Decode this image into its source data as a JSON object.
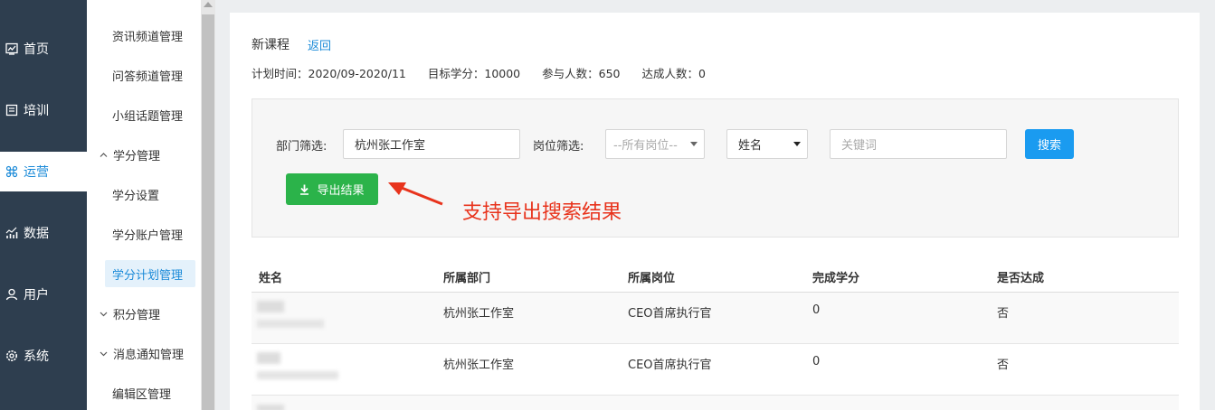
{
  "nav": {
    "items": [
      {
        "label": "首页",
        "icon": "dashboard-icon",
        "active": false
      },
      {
        "label": "培训",
        "icon": "book-icon",
        "active": false
      },
      {
        "label": "运营",
        "icon": "command-icon",
        "active": true
      },
      {
        "label": "数据",
        "icon": "bar-chart-icon",
        "active": false
      },
      {
        "label": "用户",
        "icon": "user-icon",
        "active": false
      },
      {
        "label": "系统",
        "icon": "gear-icon",
        "active": false
      }
    ]
  },
  "submenu": {
    "items": [
      {
        "label": "资讯频道管理"
      },
      {
        "label": "问答频道管理"
      },
      {
        "label": "小组话题管理"
      },
      {
        "label": "学分管理",
        "group": true
      },
      {
        "label": "学分设置"
      },
      {
        "label": "学分账户管理"
      },
      {
        "label": "学分计划管理",
        "active": true
      },
      {
        "label": "积分管理",
        "group": true
      },
      {
        "label": "消息通知管理",
        "group": true
      },
      {
        "label": "编辑区管理"
      }
    ]
  },
  "page": {
    "title": "新课程",
    "back_label": "返回",
    "stats": {
      "plan_time": "计划时间：2020/09-2020/11",
      "target_credits": "目标学分：10000",
      "participants": "参与人数：650",
      "achievers": "达成人数：0"
    }
  },
  "filter": {
    "dept_label": "部门筛选:",
    "dept_value": "杭州张工作室",
    "position_label": "岗位筛选:",
    "position_value": "--所有岗位--",
    "field_value": "姓名",
    "keyword_placeholder": "关键词",
    "search_label": "搜索",
    "export_label": "导出结果"
  },
  "annotation": {
    "text": "支持导出搜索结果",
    "color": "#e8331c"
  },
  "table": {
    "headers": [
      "姓名",
      "所属部门",
      "所属岗位",
      "完成学分",
      "是否达成"
    ],
    "rows": [
      {
        "dept": "杭州张工作室",
        "position": "CEO首席执行官",
        "credits": "0",
        "achieved": "否"
      },
      {
        "dept": "杭州张工作室",
        "position": "CEO首席执行官",
        "credits": "0",
        "achieved": "否"
      },
      {
        "dept": "",
        "position": "",
        "credits": "",
        "achieved": ""
      }
    ]
  },
  "colors": {
    "nav_bg": "#2e3e4f",
    "accent": "#1a8ad8",
    "search_button": "#1a9bf0",
    "export_button": "#2bb34a"
  }
}
